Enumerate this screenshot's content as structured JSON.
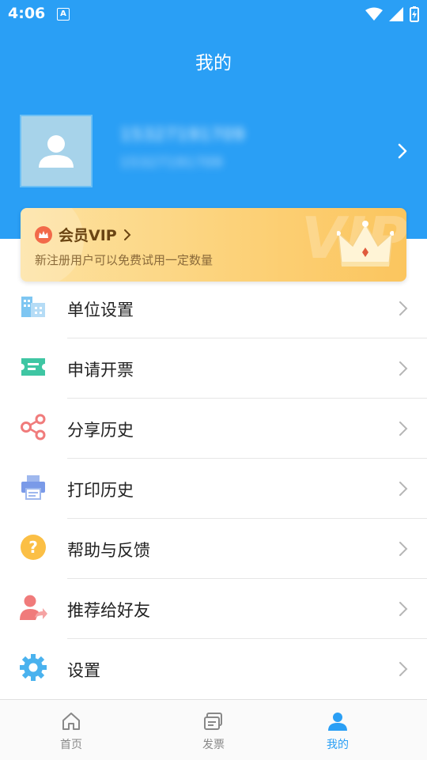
{
  "status_bar": {
    "time": "4:06",
    "app_indicator": "A"
  },
  "header": {
    "title": "我的"
  },
  "profile": {
    "name": "15327191709",
    "subtitle": "15327191709"
  },
  "vip": {
    "title": "会员VIP",
    "subtitle": "新注册用户可以免费试用一定数量",
    "watermark": "VIP"
  },
  "menu": {
    "items": [
      {
        "label": "单位设置",
        "icon": "building-icon"
      },
      {
        "label": "申请开票",
        "icon": "ticket-icon"
      },
      {
        "label": "分享历史",
        "icon": "share-icon"
      },
      {
        "label": "打印历史",
        "icon": "printer-icon"
      },
      {
        "label": "帮助与反馈",
        "icon": "help-icon"
      },
      {
        "label": "推荐给好友",
        "icon": "recommend-user-icon"
      },
      {
        "label": "设置",
        "icon": "gear-icon"
      }
    ]
  },
  "tabs": [
    {
      "label": "首页",
      "icon": "home-icon",
      "active": false
    },
    {
      "label": "发票",
      "icon": "invoice-icon",
      "active": false
    },
    {
      "label": "我的",
      "icon": "user-icon",
      "active": true
    }
  ],
  "colors": {
    "primary": "#2a9ff5",
    "vip_gold": "#fcd27a",
    "text": "#222222"
  }
}
